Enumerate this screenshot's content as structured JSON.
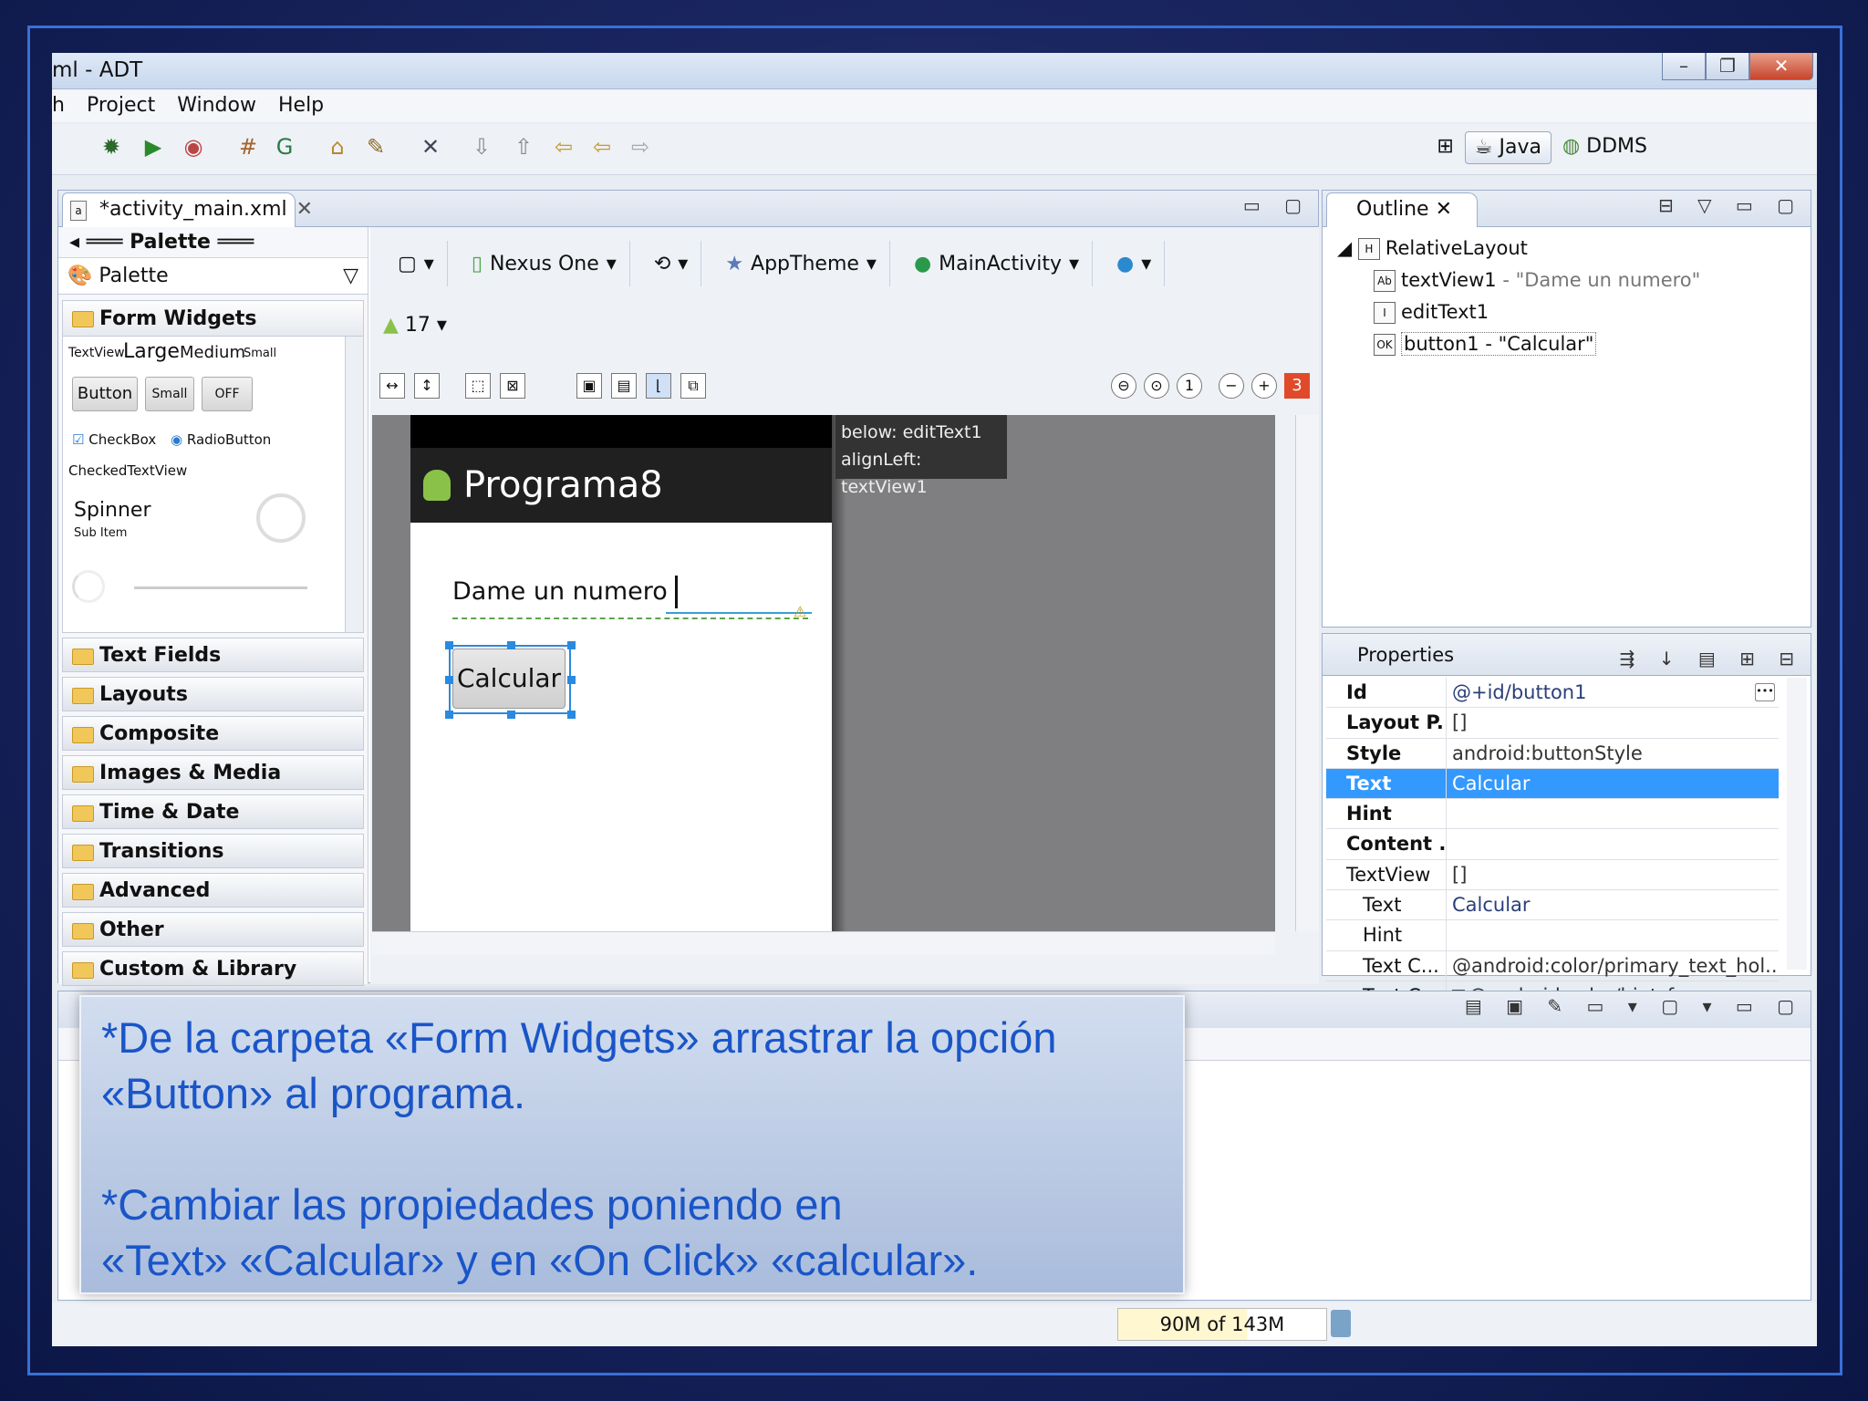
{
  "window": {
    "title": "ml - ADT"
  },
  "menu": [
    "h",
    "Project",
    "Window",
    "Help"
  ],
  "perspectives": {
    "java": "Java",
    "ddms": "DDMS"
  },
  "editor_tab": {
    "label": "*activity_main.xml",
    "close": "✕"
  },
  "palette": {
    "header": "Palette",
    "selector": "Palette",
    "open_category": "Form Widgets",
    "widgets": {
      "textview": "TextView",
      "large": "Large",
      "medium": "Medium",
      "small": "Small",
      "button": "Button",
      "small_button": "Small",
      "off": "OFF",
      "checkbox": "CheckBox",
      "radiobutton": "RadioButton",
      "checkedtextview": "CheckedTextView",
      "spinner": "Spinner",
      "subitem": "Sub Item"
    },
    "categories": [
      "Text Fields",
      "Layouts",
      "Composite",
      "Images & Media",
      "Time & Date",
      "Transitions",
      "Advanced",
      "Other",
      "Custom & Library Views"
    ]
  },
  "config": {
    "device": "Nexus One",
    "theme": "AppTheme",
    "activity": "MainActivity",
    "api": "17"
  },
  "error_count": "3",
  "canvas": {
    "app_title": "Programa8",
    "label": "Dame un numero",
    "button": "Calcular",
    "tooltip_1": "below: editText1",
    "tooltip_2": "alignLeft: textView1"
  },
  "outline": {
    "title": "Outline",
    "root": "RelativeLayout",
    "items": [
      {
        "name": "textView1",
        "detail": " - \"Dame un numero\""
      },
      {
        "name": "editText1",
        "detail": ""
      },
      {
        "name": "button1",
        "detail": " - \"Calcular\""
      }
    ]
  },
  "properties": {
    "title": "Properties",
    "rows": [
      {
        "key": "Id",
        "value": "@+id/button1"
      },
      {
        "key": "Layout P...",
        "value": "[]"
      },
      {
        "key": "Style",
        "value": "android:buttonStyle"
      },
      {
        "key": "Text",
        "value": "Calcular"
      },
      {
        "key": "Hint",
        "value": ""
      },
      {
        "key": "Content ...",
        "value": ""
      },
      {
        "key": "TextView",
        "value": "[]"
      },
      {
        "key": "Text",
        "value": "Calcular"
      },
      {
        "key": "Hint",
        "value": ""
      },
      {
        "key": "Text C...",
        "value": "@android:color/primary_text_hol..."
      },
      {
        "key": "Text C...",
        "value": "@android:color/hint_foregrou..."
      }
    ]
  },
  "status": {
    "memory": "90M of 143M"
  },
  "note": {
    "line1": "*De la carpeta «Form Widgets» arrastrar la opción",
    "line2": "«Button» al programa.",
    "line3": "*Cambiar las propiedades poniendo en",
    "line4": "«Text» «Calcular» y en «On Click» «calcular»."
  }
}
